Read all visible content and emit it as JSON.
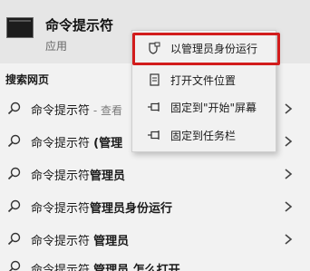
{
  "best_match": {
    "title": "命令提示符",
    "subtitle": "应用"
  },
  "section_title": "搜索网页",
  "context_menu": {
    "items": [
      {
        "label": "以管理员身份运行",
        "icon": "shield-icon"
      },
      {
        "label": "打开文件位置",
        "icon": "folder-icon"
      },
      {
        "label": "固定到\"开始\"屏幕",
        "icon": "pin-icon"
      },
      {
        "label": "固定到任务栏",
        "icon": "pin-icon"
      }
    ],
    "highlight_color": "#d21c1c"
  },
  "search_items": [
    {
      "prefix": "命令提示符",
      "suffix": " - 查看",
      "suffix_style": "muted"
    },
    {
      "prefix": "命令提示符 ",
      "suffix": "(管理",
      "suffix_style": "bold"
    },
    {
      "prefix": "命令提示符",
      "suffix": "管理员",
      "suffix_style": "bold"
    },
    {
      "prefix": "命令提示符",
      "suffix": "管理员身份运行",
      "suffix_style": "bold"
    },
    {
      "prefix": "命令提示符 ",
      "suffix": "管理员",
      "suffix_style": "bold"
    },
    {
      "prefix": "命令提示符 ",
      "suffix": "管理员 怎么打开",
      "suffix_style": "bold"
    }
  ]
}
